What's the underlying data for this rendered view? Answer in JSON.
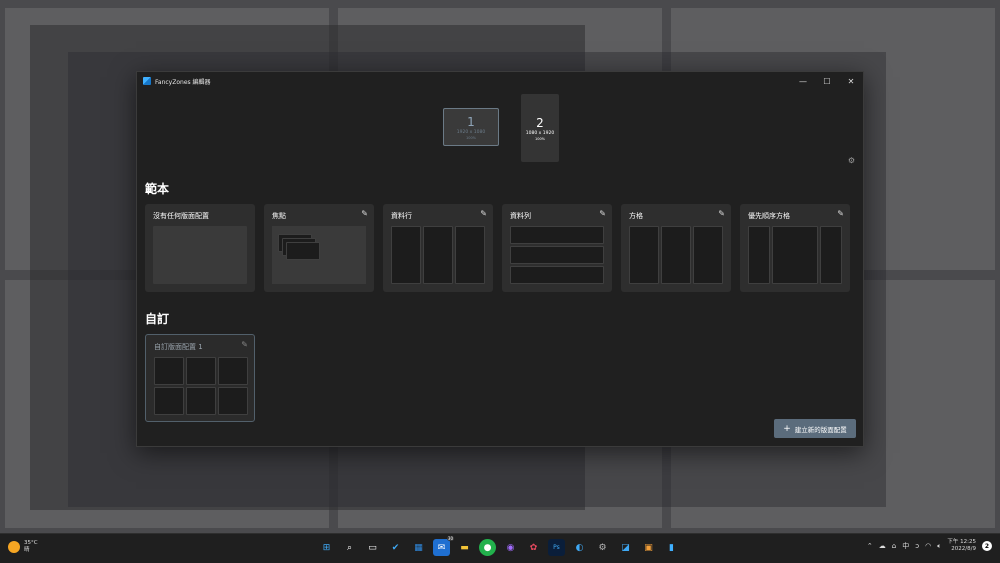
{
  "window": {
    "title": "FancyZones 編輯器",
    "controls": {
      "minimize": "—",
      "maximize": "☐",
      "close": "✕"
    }
  },
  "monitors": [
    {
      "number": "1",
      "resolution": "1920 x 1080",
      "scale": "100%"
    },
    {
      "number": "2",
      "resolution": "1080 x 1920",
      "scale": "100%"
    }
  ],
  "icons": {
    "settings": "gear-icon",
    "edit": "pencil-icon",
    "add": "plus-icon"
  },
  "templates": {
    "heading": "範本",
    "cards": [
      {
        "label": "沒有任何版面配置",
        "editable": false
      },
      {
        "label": "焦點",
        "editable": true
      },
      {
        "label": "資料行",
        "editable": true
      },
      {
        "label": "資料列",
        "editable": true
      },
      {
        "label": "方格",
        "editable": true
      },
      {
        "label": "優先順序方格",
        "editable": true
      }
    ]
  },
  "custom": {
    "heading": "自訂",
    "cards": [
      {
        "label": "自訂版面配置 1",
        "editable": true
      }
    ]
  },
  "actions": {
    "new_layout": "建立新的版面配置"
  },
  "taskbar": {
    "weather": {
      "temp": "35°C",
      "condition": "晴"
    },
    "tray": {
      "language": "中"
    },
    "clock": {
      "time": "下午 12:25",
      "date": "2022/8/9"
    },
    "notifications": "2",
    "badge": "30",
    "ps_label": "Ps"
  },
  "colors": {
    "accent": "#5b6c7c",
    "window_bg": "#202020",
    "card_bg": "#2e2e2e"
  }
}
